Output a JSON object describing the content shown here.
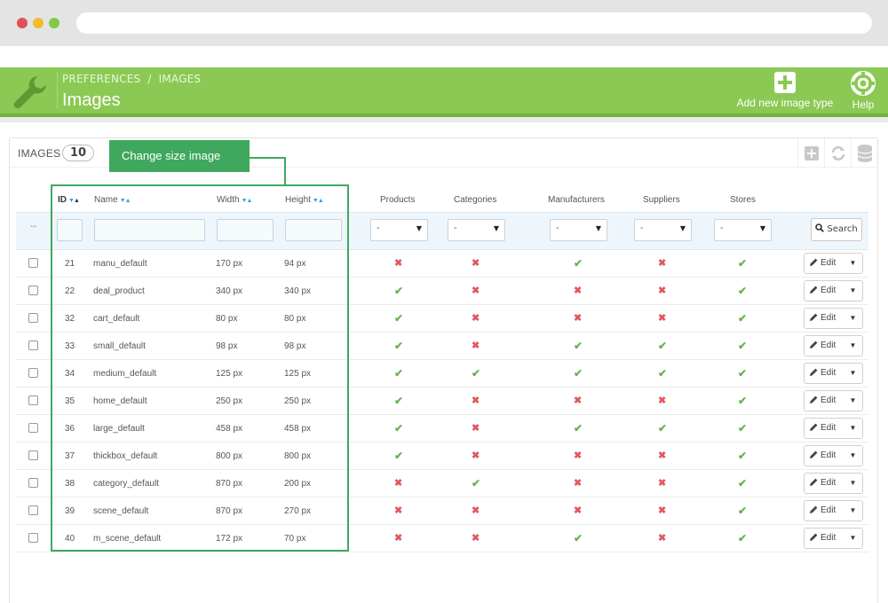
{
  "header": {
    "breadcrumb": [
      "PREFERENCES",
      "IMAGES"
    ],
    "breadcrumb_sep": "/",
    "title": "Images",
    "add_button_label": "Add new image type",
    "help_button_label": "Help",
    "colors": {
      "header": "#8bc954",
      "accent": "#3fa85e"
    }
  },
  "panel": {
    "title": "IMAGES",
    "count": "10",
    "tool_icons": [
      "add-icon",
      "refresh-icon",
      "database-icon"
    ]
  },
  "callout": {
    "label": "Change size image"
  },
  "table": {
    "columns": {
      "id": "ID",
      "name": "Name",
      "width": "Width",
      "height": "Height",
      "products": "Products",
      "categories": "Categories",
      "manufacturers": "Manufacturers",
      "suppliers": "Suppliers",
      "stores": "Stores"
    },
    "filter": {
      "dash": "--",
      "select_value": "-",
      "search_label": "Search"
    },
    "edit_label": "Edit",
    "rows": [
      {
        "id": "21",
        "name": "manu_default",
        "width": "170 px",
        "height": "94 px",
        "products": false,
        "categories": false,
        "manufacturers": true,
        "suppliers": false,
        "stores": true
      },
      {
        "id": "22",
        "name": "deal_product",
        "width": "340 px",
        "height": "340 px",
        "products": true,
        "categories": false,
        "manufacturers": false,
        "suppliers": false,
        "stores": true
      },
      {
        "id": "32",
        "name": "cart_default",
        "width": "80 px",
        "height": "80 px",
        "products": true,
        "categories": false,
        "manufacturers": false,
        "suppliers": false,
        "stores": true
      },
      {
        "id": "33",
        "name": "small_default",
        "width": "98 px",
        "height": "98 px",
        "products": true,
        "categories": false,
        "manufacturers": true,
        "suppliers": true,
        "stores": true
      },
      {
        "id": "34",
        "name": "medium_default",
        "width": "125 px",
        "height": "125 px",
        "products": true,
        "categories": true,
        "manufacturers": true,
        "suppliers": true,
        "stores": true
      },
      {
        "id": "35",
        "name": "home_default",
        "width": "250 px",
        "height": "250 px",
        "products": true,
        "categories": false,
        "manufacturers": false,
        "suppliers": false,
        "stores": true
      },
      {
        "id": "36",
        "name": "large_default",
        "width": "458 px",
        "height": "458 px",
        "products": true,
        "categories": false,
        "manufacturers": true,
        "suppliers": true,
        "stores": true
      },
      {
        "id": "37",
        "name": "thickbox_default",
        "width": "800 px",
        "height": "800 px",
        "products": true,
        "categories": false,
        "manufacturers": false,
        "suppliers": false,
        "stores": true
      },
      {
        "id": "38",
        "name": "category_default",
        "width": "870 px",
        "height": "200 px",
        "products": false,
        "categories": true,
        "manufacturers": false,
        "suppliers": false,
        "stores": true
      },
      {
        "id": "39",
        "name": "scene_default",
        "width": "870 px",
        "height": "270 px",
        "products": false,
        "categories": false,
        "manufacturers": false,
        "suppliers": false,
        "stores": true
      },
      {
        "id": "40",
        "name": "m_scene_default",
        "width": "172 px",
        "height": "70 px",
        "products": false,
        "categories": false,
        "manufacturers": true,
        "suppliers": false,
        "stores": true
      }
    ]
  }
}
